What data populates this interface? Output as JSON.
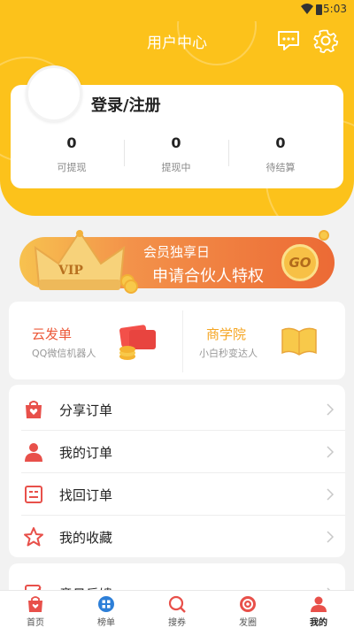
{
  "status_bar": {
    "time": "5:03"
  },
  "header": {
    "title": "用户中心",
    "icons": [
      "message-icon",
      "gear-icon"
    ]
  },
  "user_card": {
    "login_label": "登录/注册",
    "stats": [
      {
        "value": "0",
        "label": "可提现"
      },
      {
        "value": "0",
        "label": "提现中"
      },
      {
        "value": "0",
        "label": "待结算"
      }
    ]
  },
  "vip_banner": {
    "badge": "VIP",
    "line1": "会员独享日",
    "line2": "申请合伙人特权",
    "go": "GO"
  },
  "tools": [
    {
      "title": "云发单",
      "subtitle": "QQ微信机器人",
      "color": "#ec5a3a"
    },
    {
      "title": "商学院",
      "subtitle": "小白秒变达人",
      "color": "#f5a623"
    }
  ],
  "menu": [
    {
      "label": "分享订单",
      "icon": "shopping-bag-heart-icon"
    },
    {
      "label": "我的订单",
      "icon": "person-icon"
    },
    {
      "label": "找回订单",
      "icon": "list-document-icon"
    },
    {
      "label": "我的收藏",
      "icon": "star-icon"
    }
  ],
  "menu_partial": {
    "label": "意见反馈",
    "icon": "edit-icon"
  },
  "tabbar": [
    {
      "label": "首页",
      "icon": "home-bag-icon"
    },
    {
      "label": "榜单",
      "icon": "ranking-icon"
    },
    {
      "label": "搜券",
      "icon": "search-coupon-icon"
    },
    {
      "label": "发圈",
      "icon": "circle-share-icon"
    },
    {
      "label": "我的",
      "icon": "profile-icon",
      "active": true
    }
  ],
  "colors": {
    "brand_yellow": "#fcc21b",
    "accent_red": "#e8504a",
    "orange": "#ec6a35"
  }
}
